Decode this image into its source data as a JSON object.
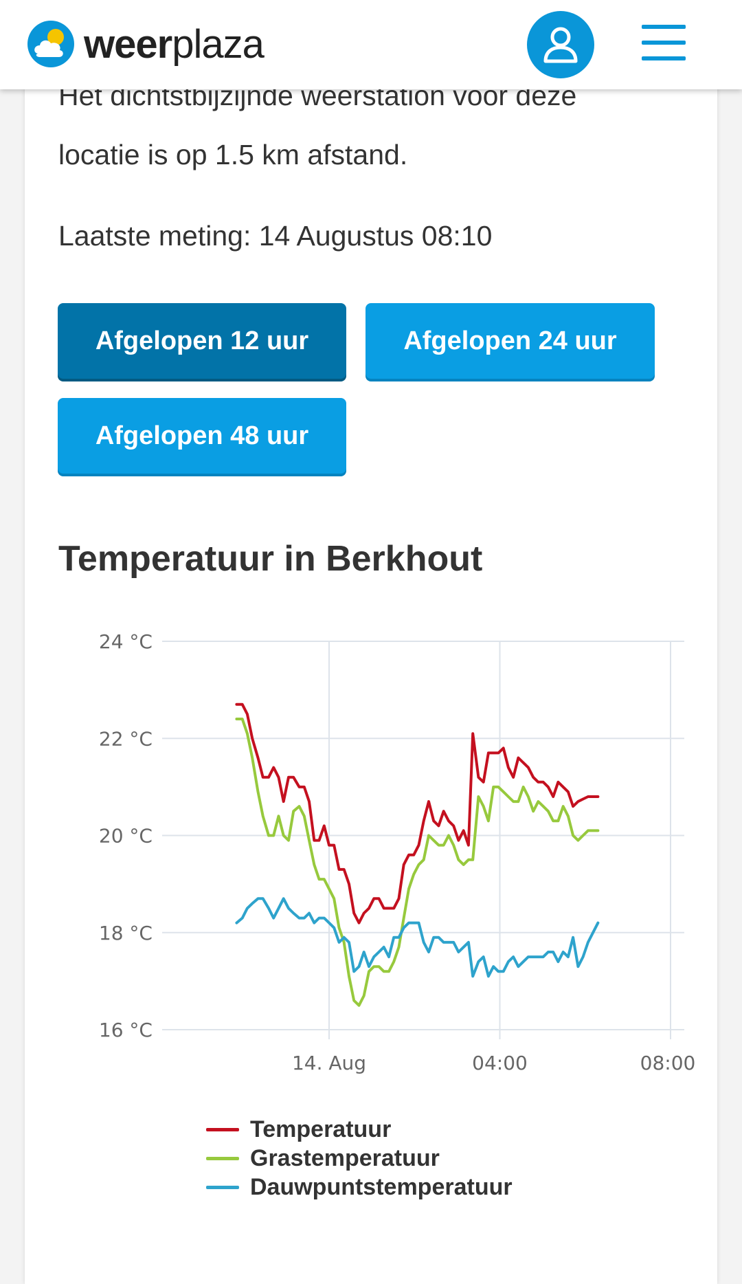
{
  "header": {
    "logo_part1": "weer",
    "logo_part2": "plaza",
    "user_icon": "user-icon",
    "menu_icon": "hamburger-menu-icon"
  },
  "intro": {
    "line1": "Het dichtstbijzijnde weerstation voor deze",
    "line2": "locatie is op 1.5 km afstand."
  },
  "last_measurement": "Laatste meting: 14 Augustus 08:10",
  "tabs": [
    {
      "label": "Afgelopen 12 uur",
      "active": true
    },
    {
      "label": "Afgelopen 24 uur",
      "active": false
    },
    {
      "label": "Afgelopen 48 uur",
      "active": false
    }
  ],
  "chart_title": "Temperatuur in Berkhout",
  "colors": {
    "brand_blue": "#0a96d8",
    "button_active": "#0273a8",
    "button_inactive": "#0a9ee3",
    "temperature": "#c4101f",
    "grass_temperature": "#97c93d",
    "dewpoint": "#2ea3cc"
  },
  "chart_data": {
    "type": "line",
    "title": "Temperatuur in Berkhout",
    "ylim": [
      16,
      24
    ],
    "y_ticks": [
      "24 °C",
      "22 °C",
      "20 °C",
      "18 °C",
      "16 °C"
    ],
    "y_tick_values": [
      24,
      22,
      20,
      18,
      16
    ],
    "x_ticks": [
      "14. Aug",
      "04:00",
      "08:00"
    ],
    "x_tick_times": [
      0,
      240,
      480
    ],
    "xlim": [
      -130,
      490
    ],
    "x_unit": "minutes relative to 14 Aug 00:00",
    "grid": true,
    "legend_position": "bottom",
    "series": [
      {
        "name": "Temperatuur",
        "color": "#c4101f",
        "points": [
          [
            -130,
            22.7
          ],
          [
            -122,
            22.7
          ],
          [
            -115,
            22.5
          ],
          [
            -108,
            22.0
          ],
          [
            -100,
            21.6
          ],
          [
            -93,
            21.2
          ],
          [
            -85,
            21.2
          ],
          [
            -78,
            21.4
          ],
          [
            -71,
            21.2
          ],
          [
            -64,
            20.7
          ],
          [
            -57,
            21.2
          ],
          [
            -50,
            21.2
          ],
          [
            -42,
            21.0
          ],
          [
            -35,
            21.0
          ],
          [
            -28,
            20.7
          ],
          [
            -21,
            19.9
          ],
          [
            -14,
            19.9
          ],
          [
            -7,
            20.2
          ],
          [
            0,
            19.8
          ],
          [
            7,
            19.8
          ],
          [
            14,
            19.3
          ],
          [
            21,
            19.3
          ],
          [
            28,
            19.0
          ],
          [
            35,
            18.4
          ],
          [
            42,
            18.2
          ],
          [
            49,
            18.4
          ],
          [
            56,
            18.5
          ],
          [
            63,
            18.7
          ],
          [
            70,
            18.7
          ],
          [
            77,
            18.5
          ],
          [
            84,
            18.5
          ],
          [
            91,
            18.5
          ],
          [
            98,
            18.7
          ],
          [
            105,
            19.4
          ],
          [
            112,
            19.6
          ],
          [
            119,
            19.6
          ],
          [
            126,
            19.8
          ],
          [
            133,
            20.3
          ],
          [
            140,
            20.7
          ],
          [
            147,
            20.3
          ],
          [
            154,
            20.2
          ],
          [
            161,
            20.5
          ],
          [
            168,
            20.3
          ],
          [
            175,
            20.2
          ],
          [
            182,
            19.9
          ],
          [
            189,
            20.1
          ],
          [
            196,
            19.8
          ],
          [
            202,
            22.1
          ],
          [
            210,
            21.2
          ],
          [
            217,
            21.1
          ],
          [
            224,
            21.7
          ],
          [
            231,
            21.7
          ],
          [
            238,
            21.7
          ],
          [
            245,
            21.8
          ],
          [
            252,
            21.4
          ],
          [
            259,
            21.2
          ],
          [
            266,
            21.6
          ],
          [
            273,
            21.5
          ],
          [
            280,
            21.4
          ],
          [
            287,
            21.2
          ],
          [
            294,
            21.1
          ],
          [
            301,
            21.1
          ],
          [
            308,
            21.0
          ],
          [
            315,
            20.8
          ],
          [
            322,
            21.1
          ],
          [
            329,
            21.0
          ],
          [
            336,
            20.9
          ],
          [
            343,
            20.6
          ],
          [
            350,
            20.7
          ],
          [
            357,
            20.75
          ],
          [
            364,
            20.8
          ],
          [
            371,
            20.8
          ],
          [
            378,
            20.8
          ]
        ]
      },
      {
        "name": "Grastemperatuur",
        "color": "#97c93d",
        "points": [
          [
            -130,
            22.4
          ],
          [
            -122,
            22.4
          ],
          [
            -115,
            22.1
          ],
          [
            -108,
            21.6
          ],
          [
            -100,
            20.9
          ],
          [
            -93,
            20.4
          ],
          [
            -85,
            20.0
          ],
          [
            -78,
            20.0
          ],
          [
            -71,
            20.4
          ],
          [
            -64,
            20.0
          ],
          [
            -57,
            19.9
          ],
          [
            -50,
            20.5
          ],
          [
            -42,
            20.6
          ],
          [
            -35,
            20.4
          ],
          [
            -28,
            19.9
          ],
          [
            -21,
            19.4
          ],
          [
            -14,
            19.1
          ],
          [
            -7,
            19.1
          ],
          [
            0,
            18.9
          ],
          [
            7,
            18.7
          ],
          [
            14,
            18.1
          ],
          [
            21,
            17.8
          ],
          [
            28,
            17.1
          ],
          [
            35,
            16.6
          ],
          [
            42,
            16.5
          ],
          [
            49,
            16.7
          ],
          [
            56,
            17.2
          ],
          [
            63,
            17.3
          ],
          [
            70,
            17.3
          ],
          [
            77,
            17.2
          ],
          [
            84,
            17.2
          ],
          [
            91,
            17.4
          ],
          [
            98,
            17.7
          ],
          [
            105,
            18.3
          ],
          [
            112,
            18.9
          ],
          [
            119,
            19.2
          ],
          [
            126,
            19.4
          ],
          [
            133,
            19.5
          ],
          [
            140,
            20.0
          ],
          [
            147,
            19.9
          ],
          [
            154,
            19.8
          ],
          [
            161,
            19.8
          ],
          [
            168,
            20.0
          ],
          [
            175,
            19.8
          ],
          [
            182,
            19.5
          ],
          [
            189,
            19.4
          ],
          [
            196,
            19.5
          ],
          [
            202,
            19.5
          ],
          [
            210,
            20.8
          ],
          [
            217,
            20.6
          ],
          [
            224,
            20.3
          ],
          [
            231,
            21.0
          ],
          [
            238,
            21.0
          ],
          [
            245,
            20.9
          ],
          [
            252,
            20.8
          ],
          [
            259,
            20.7
          ],
          [
            266,
            20.7
          ],
          [
            273,
            21.0
          ],
          [
            280,
            20.8
          ],
          [
            287,
            20.5
          ],
          [
            294,
            20.7
          ],
          [
            301,
            20.6
          ],
          [
            308,
            20.5
          ],
          [
            315,
            20.3
          ],
          [
            322,
            20.3
          ],
          [
            329,
            20.6
          ],
          [
            336,
            20.4
          ],
          [
            343,
            20.0
          ],
          [
            350,
            19.9
          ],
          [
            357,
            20.0
          ],
          [
            364,
            20.1
          ],
          [
            371,
            20.1
          ],
          [
            378,
            20.1
          ]
        ]
      },
      {
        "name": "Dauwpuntstemperatuur",
        "color": "#2ea3cc",
        "points": [
          [
            -130,
            18.2
          ],
          [
            -122,
            18.3
          ],
          [
            -115,
            18.5
          ],
          [
            -108,
            18.6
          ],
          [
            -100,
            18.7
          ],
          [
            -93,
            18.7
          ],
          [
            -85,
            18.5
          ],
          [
            -78,
            18.3
          ],
          [
            -71,
            18.5
          ],
          [
            -64,
            18.7
          ],
          [
            -57,
            18.5
          ],
          [
            -50,
            18.4
          ],
          [
            -42,
            18.3
          ],
          [
            -35,
            18.3
          ],
          [
            -28,
            18.4
          ],
          [
            -21,
            18.2
          ],
          [
            -14,
            18.3
          ],
          [
            -7,
            18.3
          ],
          [
            0,
            18.2
          ],
          [
            7,
            18.1
          ],
          [
            14,
            17.8
          ],
          [
            21,
            17.9
          ],
          [
            28,
            17.8
          ],
          [
            35,
            17.2
          ],
          [
            42,
            17.3
          ],
          [
            49,
            17.6
          ],
          [
            56,
            17.3
          ],
          [
            63,
            17.5
          ],
          [
            70,
            17.6
          ],
          [
            77,
            17.7
          ],
          [
            84,
            17.5
          ],
          [
            91,
            17.9
          ],
          [
            98,
            17.9
          ],
          [
            105,
            18.1
          ],
          [
            112,
            18.2
          ],
          [
            119,
            18.2
          ],
          [
            126,
            18.2
          ],
          [
            133,
            17.8
          ],
          [
            140,
            17.6
          ],
          [
            147,
            17.9
          ],
          [
            154,
            17.9
          ],
          [
            161,
            17.8
          ],
          [
            168,
            17.8
          ],
          [
            175,
            17.8
          ],
          [
            182,
            17.6
          ],
          [
            189,
            17.7
          ],
          [
            196,
            17.8
          ],
          [
            202,
            17.1
          ],
          [
            210,
            17.4
          ],
          [
            217,
            17.5
          ],
          [
            224,
            17.1
          ],
          [
            231,
            17.3
          ],
          [
            238,
            17.2
          ],
          [
            245,
            17.2
          ],
          [
            252,
            17.4
          ],
          [
            259,
            17.5
          ],
          [
            266,
            17.3
          ],
          [
            273,
            17.4
          ],
          [
            280,
            17.5
          ],
          [
            287,
            17.5
          ],
          [
            294,
            17.5
          ],
          [
            301,
            17.5
          ],
          [
            308,
            17.6
          ],
          [
            315,
            17.6
          ],
          [
            322,
            17.4
          ],
          [
            329,
            17.6
          ],
          [
            336,
            17.5
          ],
          [
            343,
            17.9
          ],
          [
            350,
            17.3
          ],
          [
            357,
            17.5
          ],
          [
            364,
            17.8
          ],
          [
            371,
            18.0
          ],
          [
            378,
            18.2
          ]
        ]
      }
    ]
  }
}
